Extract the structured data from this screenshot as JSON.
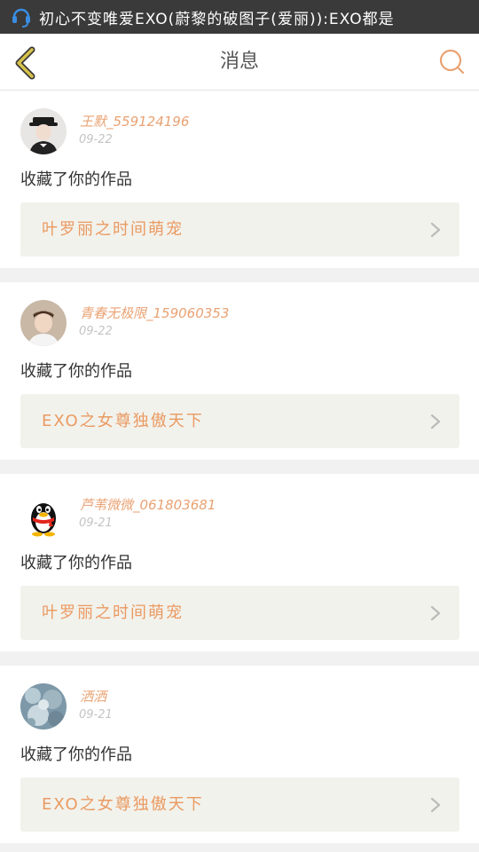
{
  "status_bar": {
    "notification_icon": "qq-headset-icon",
    "text": "初心不变唯爱EXO(蔚黎的破图子(爱丽)):EXO都是"
  },
  "header": {
    "title": "消息",
    "back_icon": "chevron-left-icon",
    "search_icon": "search-icon"
  },
  "colors": {
    "accent": "#e9a273",
    "back_arrow": "#d8c24a",
    "card_bg": "#ffffff",
    "link_bg": "#f2f2ec"
  },
  "messages": [
    {
      "username": "王默_559124196",
      "date": "09-22",
      "text": "收藏了你的作品",
      "work_title": "叶罗丽之时间萌宠",
      "avatar": "user-photo-avatar"
    },
    {
      "username": "青春无极限_159060353",
      "date": "09-22",
      "text": "收藏了你的作品",
      "work_title": "EXO之女尊独傲天下",
      "avatar": "user-photo-avatar"
    },
    {
      "username": "芦苇微微_061803681",
      "date": "09-21",
      "text": "收藏了你的作品",
      "work_title": "叶罗丽之时间萌宠",
      "avatar": "qq-penguin-avatar"
    },
    {
      "username": "洒洒",
      "date": "09-21",
      "text": "收藏了你的作品",
      "work_title": "EXO之女尊独傲天下",
      "avatar": "flower-photo-avatar"
    }
  ]
}
